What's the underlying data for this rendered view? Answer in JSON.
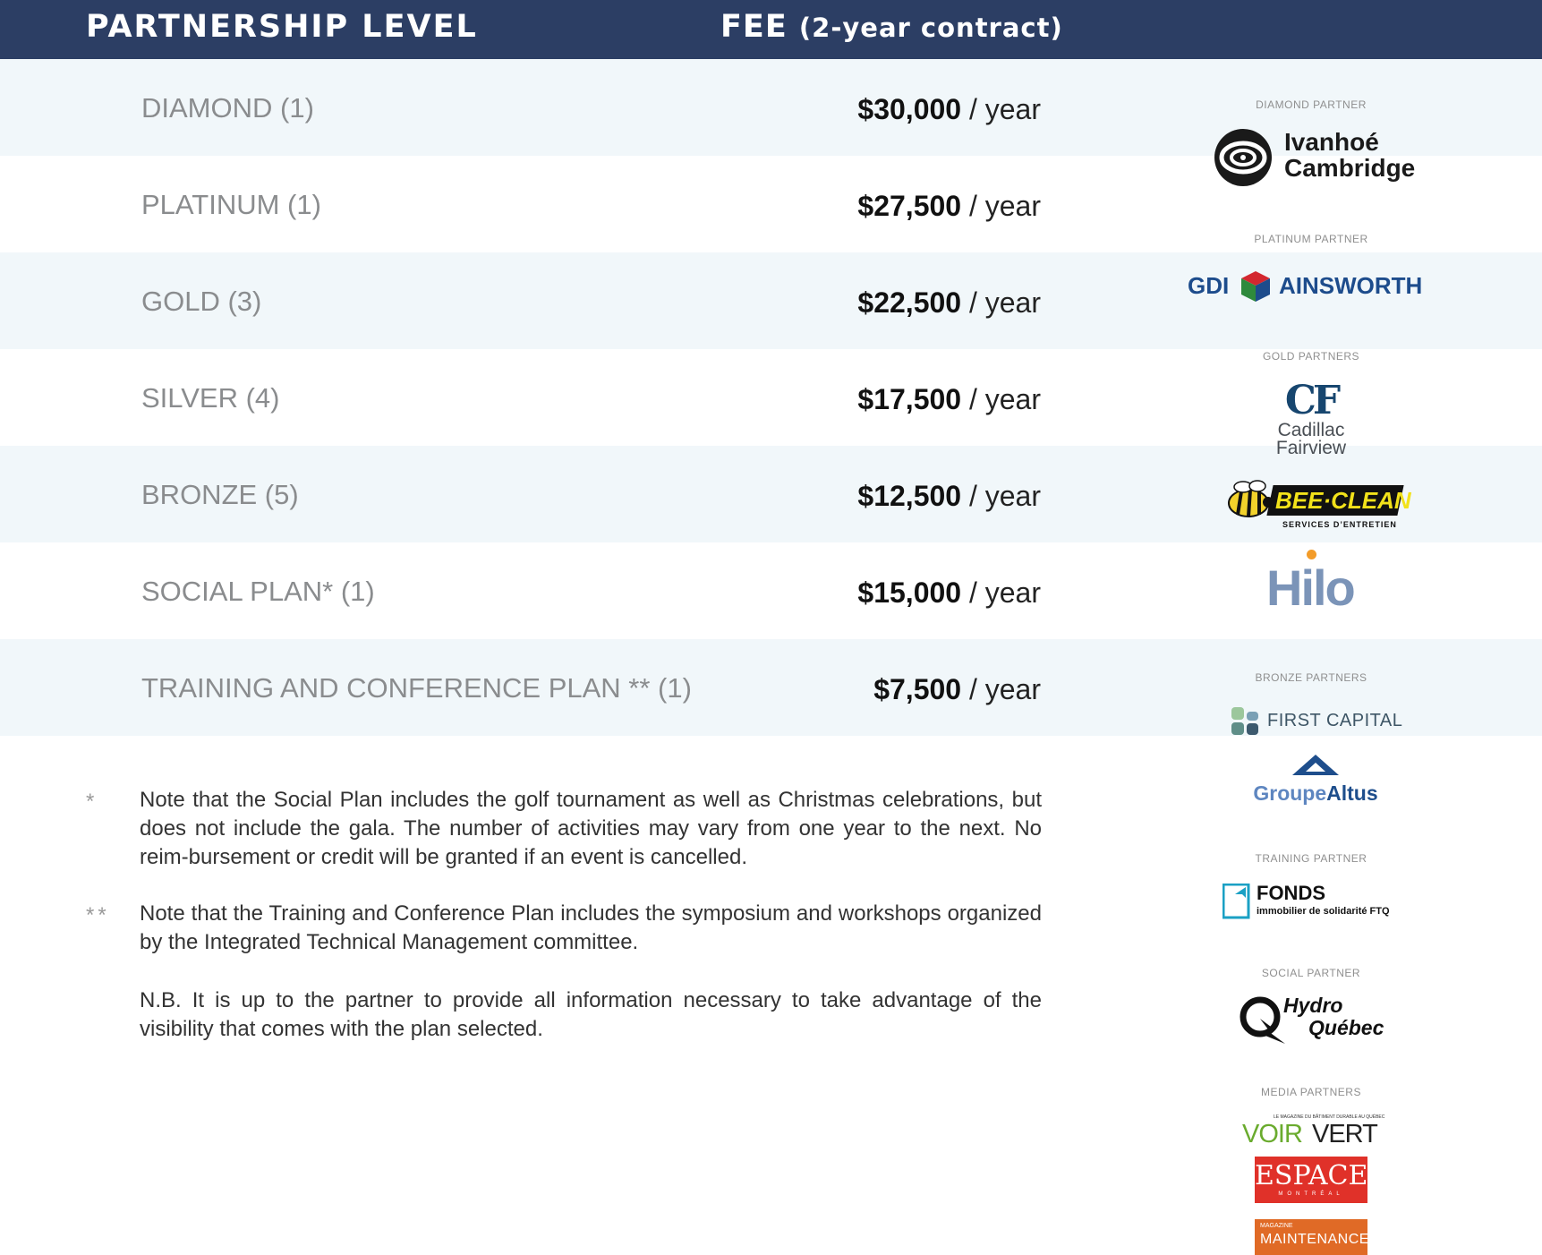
{
  "header": {
    "level_label": "PARTNERSHIP LEVEL",
    "fee_label": "FEE",
    "fee_note": "(2-year contract)"
  },
  "rows": [
    {
      "label": "DIAMOND (1)",
      "amount": "$30,000",
      "per": "/ year"
    },
    {
      "label": "PLATINUM (1)",
      "amount": "$27,500",
      "per": "/ year"
    },
    {
      "label": "GOLD (3)",
      "amount": "$22,500",
      "per": "/ year"
    },
    {
      "label": "SILVER (4)",
      "amount": "$17,500",
      "per": "/ year"
    },
    {
      "label": "BRONZE (5)",
      "amount": "$12,500",
      "per": "/ year"
    },
    {
      "label": "SOCIAL PLAN* (1)",
      "amount": "$15,000",
      "per": "/ year"
    },
    {
      "label": "TRAINING AND CONFERENCE PLAN ** (1)",
      "amount": "$7,500",
      "per": "/ year"
    }
  ],
  "notes": [
    {
      "mark": "*",
      "text": "Note that the Social Plan includes the golf tournament as well as Christmas celebrations, but does not include the gala. The number of activities may vary from one year to the next. No reim-bursement or credit will be granted if an event is cancelled."
    },
    {
      "mark": "**",
      "text": "Note that the Training and Conference Plan includes the symposium and workshops organized by the Integrated Technical Management committee."
    },
    {
      "mark": "",
      "text": "N.B. It is up to the partner to provide all information necessary to take advantage of the visibility that comes with the plan selected."
    }
  ],
  "partners": {
    "diamond_caption": "DIAMOND PARTNER",
    "diamond_logo": [
      "Ivanhoé",
      "Cambridge"
    ],
    "platinum_caption": "PLATINUM PARTNER",
    "platinum_logo": [
      "GDI",
      "AINSWORTH"
    ],
    "gold_caption": "GOLD PARTNERS",
    "cadillac_logo": [
      "CF",
      "Cadillac",
      "Fairview"
    ],
    "beeclean_logo": [
      "BEE·CLEAN",
      "SERVICES D’ENTRETIEN"
    ],
    "hilo_logo": "Hilo",
    "bronze_caption": "BRONZE PARTNERS",
    "firstcapital_logo": "FIRST CAPITAL",
    "altus_logo": [
      "Groupe",
      "Altus"
    ],
    "training_caption": "TRAINING PARTNER",
    "fonds_logo": [
      "FONDS",
      "immobilier de solidarité FTQ"
    ],
    "social_caption": "SOCIAL PARTNER",
    "hydro_logo": [
      "Hydro",
      "Québec"
    ],
    "media_caption": "MEDIA PARTNERS",
    "voirvert_logo": [
      "LE MAGAZINE DU BÂTIMENT DURABLE AU QUÉBEC",
      "VOIR",
      "VERT"
    ],
    "espace_logo": [
      "ESPACE",
      "MONTRÉAL"
    ],
    "maintenance_logo": [
      "MAGAZINE",
      "MAINTENANCE"
    ]
  },
  "colors": {
    "header_bg": "#2c3e64",
    "row_shade": "#f1f7fa",
    "label_gray": "#8a8c8e"
  }
}
